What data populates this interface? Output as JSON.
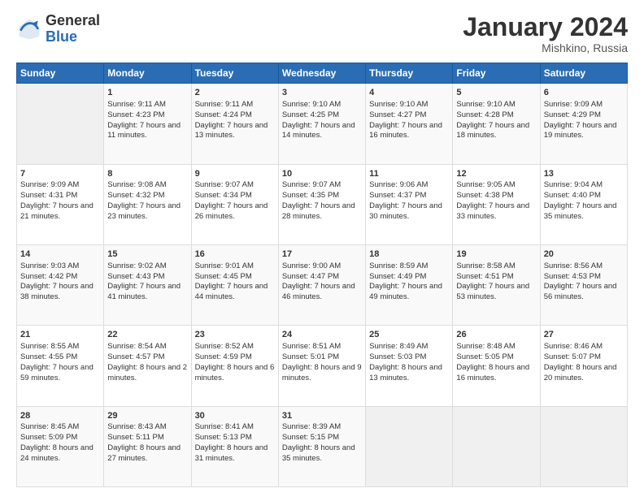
{
  "logo": {
    "general": "General",
    "blue": "Blue",
    "icon_color": "#2a6db5"
  },
  "header": {
    "month": "January 2024",
    "location": "Mishkino, Russia"
  },
  "weekdays": [
    "Sunday",
    "Monday",
    "Tuesday",
    "Wednesday",
    "Thursday",
    "Friday",
    "Saturday"
  ],
  "weeks": [
    [
      {
        "day": "",
        "sunrise": "",
        "sunset": "",
        "daylight": "",
        "empty": true
      },
      {
        "day": "1",
        "sunrise": "Sunrise: 9:11 AM",
        "sunset": "Sunset: 4:23 PM",
        "daylight": "Daylight: 7 hours and 11 minutes."
      },
      {
        "day": "2",
        "sunrise": "Sunrise: 9:11 AM",
        "sunset": "Sunset: 4:24 PM",
        "daylight": "Daylight: 7 hours and 13 minutes."
      },
      {
        "day": "3",
        "sunrise": "Sunrise: 9:10 AM",
        "sunset": "Sunset: 4:25 PM",
        "daylight": "Daylight: 7 hours and 14 minutes."
      },
      {
        "day": "4",
        "sunrise": "Sunrise: 9:10 AM",
        "sunset": "Sunset: 4:27 PM",
        "daylight": "Daylight: 7 hours and 16 minutes."
      },
      {
        "day": "5",
        "sunrise": "Sunrise: 9:10 AM",
        "sunset": "Sunset: 4:28 PM",
        "daylight": "Daylight: 7 hours and 18 minutes."
      },
      {
        "day": "6",
        "sunrise": "Sunrise: 9:09 AM",
        "sunset": "Sunset: 4:29 PM",
        "daylight": "Daylight: 7 hours and 19 minutes."
      }
    ],
    [
      {
        "day": "7",
        "sunrise": "Sunrise: 9:09 AM",
        "sunset": "Sunset: 4:31 PM",
        "daylight": "Daylight: 7 hours and 21 minutes."
      },
      {
        "day": "8",
        "sunrise": "Sunrise: 9:08 AM",
        "sunset": "Sunset: 4:32 PM",
        "daylight": "Daylight: 7 hours and 23 minutes."
      },
      {
        "day": "9",
        "sunrise": "Sunrise: 9:07 AM",
        "sunset": "Sunset: 4:34 PM",
        "daylight": "Daylight: 7 hours and 26 minutes."
      },
      {
        "day": "10",
        "sunrise": "Sunrise: 9:07 AM",
        "sunset": "Sunset: 4:35 PM",
        "daylight": "Daylight: 7 hours and 28 minutes."
      },
      {
        "day": "11",
        "sunrise": "Sunrise: 9:06 AM",
        "sunset": "Sunset: 4:37 PM",
        "daylight": "Daylight: 7 hours and 30 minutes."
      },
      {
        "day": "12",
        "sunrise": "Sunrise: 9:05 AM",
        "sunset": "Sunset: 4:38 PM",
        "daylight": "Daylight: 7 hours and 33 minutes."
      },
      {
        "day": "13",
        "sunrise": "Sunrise: 9:04 AM",
        "sunset": "Sunset: 4:40 PM",
        "daylight": "Daylight: 7 hours and 35 minutes."
      }
    ],
    [
      {
        "day": "14",
        "sunrise": "Sunrise: 9:03 AM",
        "sunset": "Sunset: 4:42 PM",
        "daylight": "Daylight: 7 hours and 38 minutes."
      },
      {
        "day": "15",
        "sunrise": "Sunrise: 9:02 AM",
        "sunset": "Sunset: 4:43 PM",
        "daylight": "Daylight: 7 hours and 41 minutes."
      },
      {
        "day": "16",
        "sunrise": "Sunrise: 9:01 AM",
        "sunset": "Sunset: 4:45 PM",
        "daylight": "Daylight: 7 hours and 44 minutes."
      },
      {
        "day": "17",
        "sunrise": "Sunrise: 9:00 AM",
        "sunset": "Sunset: 4:47 PM",
        "daylight": "Daylight: 7 hours and 46 minutes."
      },
      {
        "day": "18",
        "sunrise": "Sunrise: 8:59 AM",
        "sunset": "Sunset: 4:49 PM",
        "daylight": "Daylight: 7 hours and 49 minutes."
      },
      {
        "day": "19",
        "sunrise": "Sunrise: 8:58 AM",
        "sunset": "Sunset: 4:51 PM",
        "daylight": "Daylight: 7 hours and 53 minutes."
      },
      {
        "day": "20",
        "sunrise": "Sunrise: 8:56 AM",
        "sunset": "Sunset: 4:53 PM",
        "daylight": "Daylight: 7 hours and 56 minutes."
      }
    ],
    [
      {
        "day": "21",
        "sunrise": "Sunrise: 8:55 AM",
        "sunset": "Sunset: 4:55 PM",
        "daylight": "Daylight: 7 hours and 59 minutes."
      },
      {
        "day": "22",
        "sunrise": "Sunrise: 8:54 AM",
        "sunset": "Sunset: 4:57 PM",
        "daylight": "Daylight: 8 hours and 2 minutes."
      },
      {
        "day": "23",
        "sunrise": "Sunrise: 8:52 AM",
        "sunset": "Sunset: 4:59 PM",
        "daylight": "Daylight: 8 hours and 6 minutes."
      },
      {
        "day": "24",
        "sunrise": "Sunrise: 8:51 AM",
        "sunset": "Sunset: 5:01 PM",
        "daylight": "Daylight: 8 hours and 9 minutes."
      },
      {
        "day": "25",
        "sunrise": "Sunrise: 8:49 AM",
        "sunset": "Sunset: 5:03 PM",
        "daylight": "Daylight: 8 hours and 13 minutes."
      },
      {
        "day": "26",
        "sunrise": "Sunrise: 8:48 AM",
        "sunset": "Sunset: 5:05 PM",
        "daylight": "Daylight: 8 hours and 16 minutes."
      },
      {
        "day": "27",
        "sunrise": "Sunrise: 8:46 AM",
        "sunset": "Sunset: 5:07 PM",
        "daylight": "Daylight: 8 hours and 20 minutes."
      }
    ],
    [
      {
        "day": "28",
        "sunrise": "Sunrise: 8:45 AM",
        "sunset": "Sunset: 5:09 PM",
        "daylight": "Daylight: 8 hours and 24 minutes."
      },
      {
        "day": "29",
        "sunrise": "Sunrise: 8:43 AM",
        "sunset": "Sunset: 5:11 PM",
        "daylight": "Daylight: 8 hours and 27 minutes."
      },
      {
        "day": "30",
        "sunrise": "Sunrise: 8:41 AM",
        "sunset": "Sunset: 5:13 PM",
        "daylight": "Daylight: 8 hours and 31 minutes."
      },
      {
        "day": "31",
        "sunrise": "Sunrise: 8:39 AM",
        "sunset": "Sunset: 5:15 PM",
        "daylight": "Daylight: 8 hours and 35 minutes."
      },
      {
        "day": "",
        "sunrise": "",
        "sunset": "",
        "daylight": "",
        "empty": true
      },
      {
        "day": "",
        "sunrise": "",
        "sunset": "",
        "daylight": "",
        "empty": true
      },
      {
        "day": "",
        "sunrise": "",
        "sunset": "",
        "daylight": "",
        "empty": true
      }
    ]
  ]
}
